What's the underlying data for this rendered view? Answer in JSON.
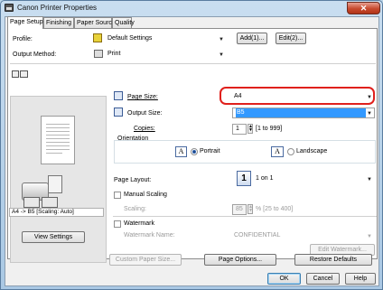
{
  "window": {
    "title": "Canon Printer Properties",
    "close_glyph": "✕"
  },
  "tabs": [
    {
      "label": "Page Setup"
    },
    {
      "label": "Finishing"
    },
    {
      "label": "Paper Source"
    },
    {
      "label": "Quality"
    }
  ],
  "profile": {
    "label": "Profile:",
    "value": "Default Settings",
    "add_label": "Add(1)...",
    "edit_label": "Edit(2)..."
  },
  "output_method": {
    "label": "Output Method:",
    "value": "Print"
  },
  "page_size": {
    "label": "Page Size:",
    "value": "A4"
  },
  "output_size": {
    "label": "Output Size:",
    "value": "B5"
  },
  "copies": {
    "label": "Copies:",
    "value": "1",
    "range": "[1 to 999]"
  },
  "orientation": {
    "label": "Orientation",
    "portrait_label": "Portrait",
    "landscape_label": "Landscape",
    "portrait_glyph": "A",
    "landscape_glyph": "A",
    "selected": "Portrait"
  },
  "page_layout": {
    "label": "Page Layout:",
    "value": "1 on 1",
    "icon_text": "1"
  },
  "manual_scaling": {
    "label": "Manual Scaling",
    "checked": false,
    "scaling_label": "Scaling:",
    "scaling_value": "85",
    "scaling_range": "% [25 to 400]"
  },
  "watermark": {
    "label": "Watermark",
    "checked": false,
    "name_label": "Watermark Name:",
    "name_value": "CONFIDENTIAL",
    "edit_label": "Edit Watermark..."
  },
  "preview": {
    "status": "A4 -> B5 [Scaling: Auto]",
    "view_settings_label": "View Settings"
  },
  "bottom_panel": {
    "custom_paper_label": "Custom Paper Size...",
    "page_options_label": "Page Options...",
    "restore_label": "Restore Defaults"
  },
  "dialog_buttons": {
    "ok": "OK",
    "cancel": "Cancel",
    "help": "Help"
  },
  "colors": {
    "accent_highlight": "#e0201c",
    "selection_blue": "#3399ff"
  }
}
